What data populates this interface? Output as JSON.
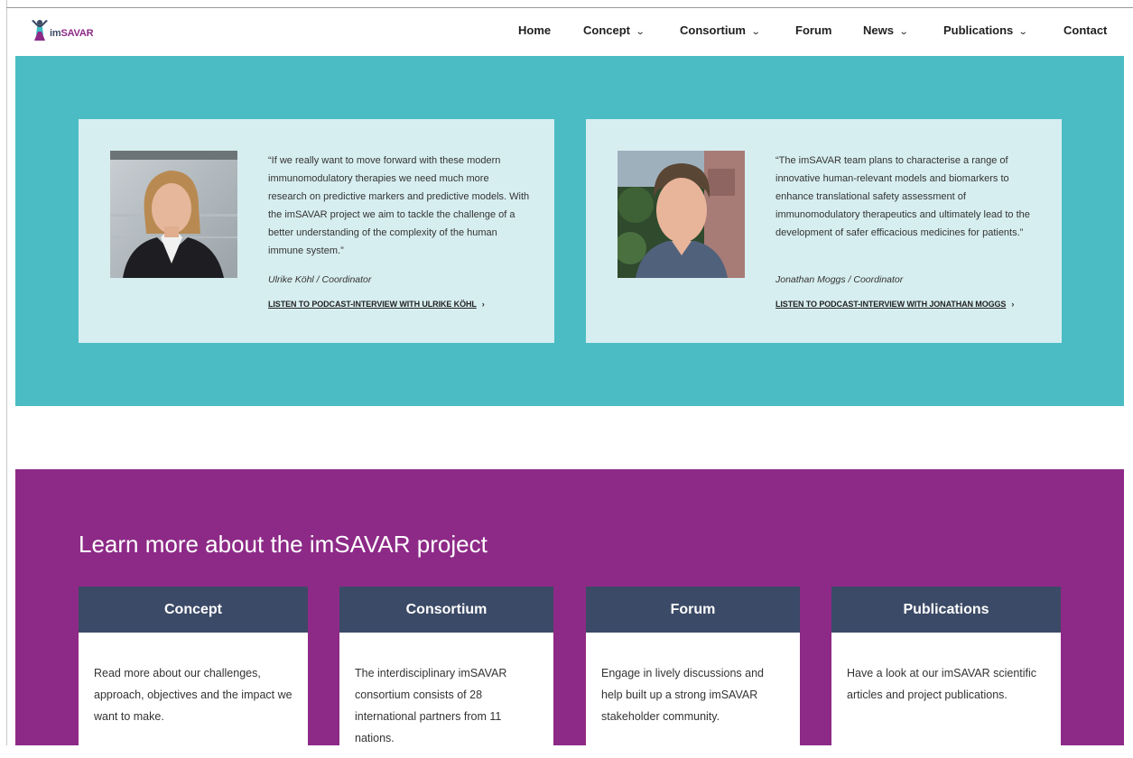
{
  "header": {
    "logo_text_prefix": "im",
    "logo_text_suffix": "SAVAR",
    "nav": [
      {
        "label": "Home",
        "has_dropdown": false
      },
      {
        "label": "Concept",
        "has_dropdown": true
      },
      {
        "label": "Consortium",
        "has_dropdown": true
      },
      {
        "label": "Forum",
        "has_dropdown": false
      },
      {
        "label": "News",
        "has_dropdown": true
      },
      {
        "label": "Publications",
        "has_dropdown": true
      },
      {
        "label": "Contact",
        "has_dropdown": false
      }
    ],
    "dropdown_icon": "⌄"
  },
  "testimonials": [
    {
      "quote": "“If we really want to move forward with these modern immunomodulatory therapies we need much more research on predictive markers and predictive models. With the imSAVAR project we aim to tackle the challenge of a better understanding of the complexity of the human immune system.”",
      "author": "Ulrike Köhl / Coordinator",
      "link": "LISTEN TO PODCAST-INTERVIEW WITH ULRIKE KÖHL"
    },
    {
      "quote": "“The imSAVAR team plans to characterise a range of innovative human-relevant models and biomarkers to enhance translational safety assessment of immunomodulatory therapeutics and ultimately lead to the development of safer efficacious medicines for patients.”",
      "author": "Jonathan Moggs / Coordinator",
      "link": "LISTEN TO PODCAST-INTERVIEW WITH JONATHAN MOGGS"
    }
  ],
  "learn_more": {
    "title": "Learn more about the imSAVAR project",
    "boxes": [
      {
        "title": "Concept",
        "text": "Read more about our challenges, approach, objectives and the impact we want to make."
      },
      {
        "title": "Consortium",
        "text": "The interdisciplinary imSAVAR consortium consists of 28 international partners from 11 nations."
      },
      {
        "title": "Forum",
        "text": "Engage in lively discussions and help built up a strong imSAVAR stakeholder community."
      },
      {
        "title": "Publications",
        "text": "Have a look at our imSAVAR scientific articles and project publications."
      }
    ]
  },
  "colors": {
    "teal": "#4bbcc4",
    "card_bg": "#d7eef0",
    "purple": "#8d2a87",
    "navy": "#3b4a66"
  },
  "icons": {
    "logo": "imsavar-person-logo-icon",
    "link_arrow": "›"
  }
}
